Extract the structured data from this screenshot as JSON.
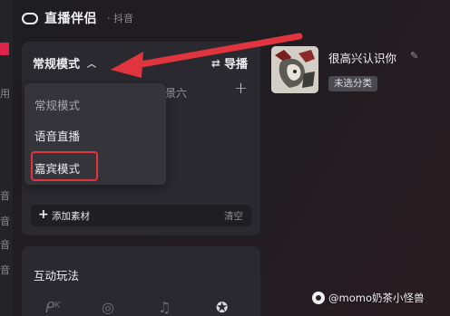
{
  "header": {
    "app_name": "直播伴侣",
    "platform": "· 抖音"
  },
  "scene_panel": {
    "mode_label": "常规模式",
    "director_label": "导播",
    "scene_tab_fragment": "景六",
    "add_material_label": "添加素材",
    "clear_label": "清空"
  },
  "mode_dropdown": {
    "options": [
      "常规模式",
      "语音直播",
      "嘉宾模式"
    ],
    "selected": "常规模式",
    "highlighted": "嘉宾模式"
  },
  "interact_panel": {
    "title": "互动玩法"
  },
  "video_card": {
    "title": "很高兴认识你",
    "tag": "未选分类"
  },
  "watermark": {
    "text": "@momo奶茶小怪兽"
  },
  "left_fragments": [
    "用",
    "音",
    "音",
    "音",
    "音"
  ],
  "annotation": {
    "arrow_color": "#e0353e",
    "box_color": "#e0353e"
  },
  "icons": {
    "logo": "logo-ring-icon",
    "swap": "swap-arrows-icon",
    "add": "plus-icon",
    "edit": "edit-pencil-icon"
  }
}
